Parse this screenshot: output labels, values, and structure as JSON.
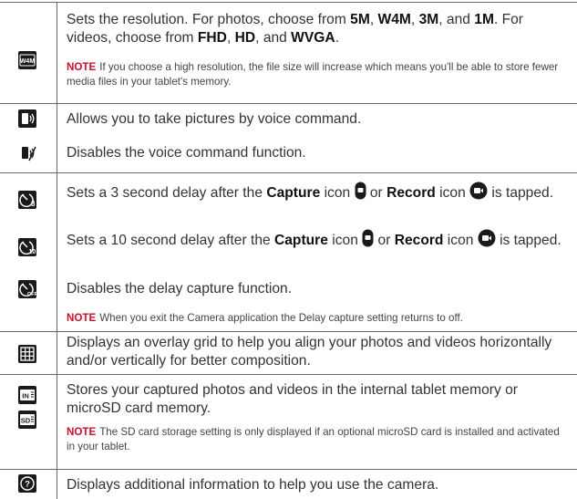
{
  "rows": {
    "resolution": {
      "icon": "w4m-resolution-icon",
      "pre": "Sets the resolution. For photos, choose from ",
      "p1": "5M",
      "s1": ", ",
      "p2": "W4M",
      "s2": ", ",
      "p3": "3M",
      "s3": ", and ",
      "p4": "1M",
      "mid": ". For videos, choose from ",
      "v1": "FHD",
      "s4": ", ",
      "v2": "HD",
      "s5": ", and ",
      "v3": "WVGA",
      "end": ".",
      "note_label": "NOTE",
      "note_text": "If you choose a high resolution, the file size will increase which means you'll be able to store fewer media files in your tablet's memory."
    },
    "voice_on": {
      "icon": "voice-shutter-on-icon",
      "text": "Allows you to take pictures by voice command."
    },
    "voice_off": {
      "icon": "voice-shutter-off-icon",
      "text": "Disables the voice command function."
    },
    "timer3": {
      "icon": "timer-3-icon",
      "a": "Sets a 3 second delay after the ",
      "capture": "Capture",
      "b": " icon ",
      "c": " or ",
      "record": "Record",
      "d": " icon ",
      "e": " is tapped."
    },
    "timer10": {
      "icon": "timer-10-icon",
      "a": "Sets a 10 second delay after the ",
      "capture": "Capture",
      "b": " icon ",
      "c": " or ",
      "record": "Record",
      "d": " icon ",
      "e": " is tapped."
    },
    "timer_off": {
      "icon": "timer-off-icon",
      "text": "Disables the delay capture function.",
      "note_label": "NOTE",
      "note_text": "When you exit the Camera application the Delay capture setting returns to off."
    },
    "grid": {
      "icon": "grid-icon",
      "text": "Displays an overlay grid to help you align your photos and videos horizontally and/or vertically for better composition."
    },
    "storage": {
      "icon_in": "internal-storage-icon",
      "icon_in_label": "IN",
      "icon_sd": "sd-storage-icon",
      "icon_sd_label": "SD",
      "text": "Stores your captured photos and videos in the internal tablet memory or microSD card memory.",
      "note_label": "NOTE",
      "note_text": "The SD card storage setting is only displayed if an optional microSD card is installed and activated in your tablet."
    },
    "help": {
      "icon": "help-icon",
      "icon_label": "?",
      "text": "Displays additional information to help you use the camera."
    }
  }
}
